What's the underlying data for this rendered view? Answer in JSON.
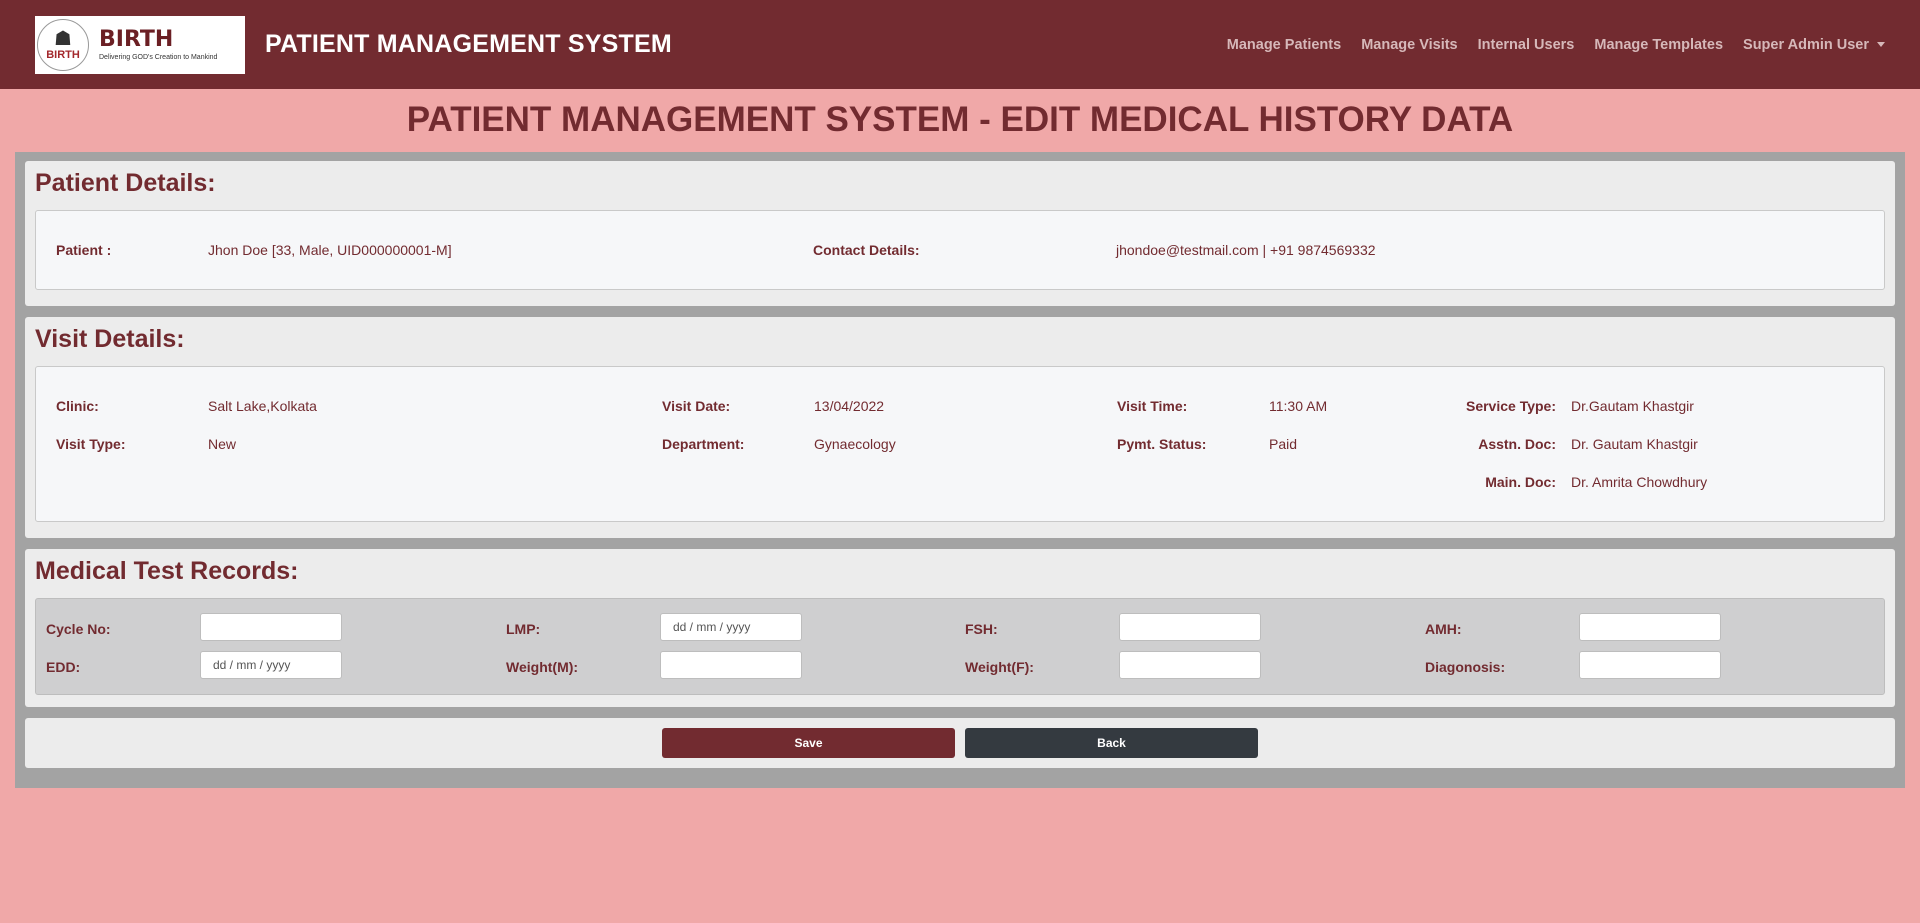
{
  "brand": {
    "logo_name": "BIRTH",
    "logo_tagline": "Delivering GOD's Creation to Mankind",
    "logo_circle_text": "BIRTH",
    "title": "PATIENT MANAGEMENT SYSTEM"
  },
  "nav": {
    "items": [
      "Manage Patients",
      "Manage Visits",
      "Internal Users",
      "Manage Templates"
    ],
    "user": "Super Admin User"
  },
  "page": {
    "title": "PATIENT MANAGEMENT SYSTEM - EDIT MEDICAL HISTORY DATA"
  },
  "patient_details": {
    "heading": "Patient Details:",
    "patient_label": "Patient :",
    "patient_value": "Jhon Doe [33, Male, UID000000001-M]",
    "contact_label": "Contact Details:",
    "contact_value": "jhondoe@testmail.com | +91 9874569332"
  },
  "visit_details": {
    "heading": "Visit Details:",
    "clinic_label": "Clinic:",
    "clinic_value": "Salt Lake,Kolkata",
    "visit_date_label": "Visit Date:",
    "visit_date_value": "13/04/2022",
    "visit_time_label": "Visit Time:",
    "visit_time_value": "11:30 AM",
    "service_type_label": "Service Type:",
    "service_type_value": "Dr.Gautam Khastgir",
    "visit_type_label": "Visit Type:",
    "visit_type_value": "New",
    "department_label": "Department:",
    "department_value": "Gynaecology",
    "pymt_status_label": "Pymt. Status:",
    "pymt_status_value": "Paid",
    "asstn_doc_label": "Asstn. Doc:",
    "asstn_doc_value": "Dr. Gautam Khastgir",
    "main_doc_label": "Main. Doc:",
    "main_doc_value": "Dr. Amrita Chowdhury"
  },
  "medical_tests": {
    "heading": "Medical Test Records:",
    "cycle_label": "Cycle No:",
    "cycle_value": "",
    "lmp_label": "LMP:",
    "lmp_placeholder": "dd / mm / yyyy",
    "fsh_label": "FSH:",
    "fsh_value": "",
    "amh_label": "AMH:",
    "amh_value": "",
    "edd_label": "EDD:",
    "edd_placeholder": "dd / mm / yyyy",
    "weight_m_label": "Weight(M):",
    "weight_m_value": "",
    "weight_f_label": "Weight(F):",
    "weight_f_value": "",
    "diagnosis_label": "Diagonosis:",
    "diagnosis_value": ""
  },
  "actions": {
    "save": "Save",
    "back": "Back"
  },
  "colors": {
    "navbar": "#722b30",
    "page_bg": "#f0a8a8",
    "text": "#722b30",
    "save_button": "#722b30",
    "back_button": "#343a40"
  }
}
